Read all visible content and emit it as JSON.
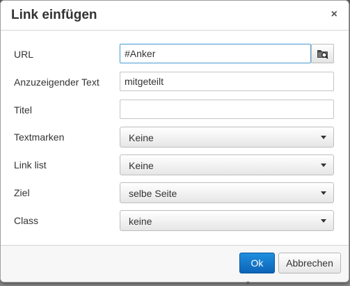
{
  "dialog": {
    "title": "Link einfügen",
    "close_glyph": "×"
  },
  "form": {
    "url": {
      "label": "URL",
      "value": "#Anker",
      "browse_icon": "folder-search-icon"
    },
    "text": {
      "label": "Anzuzeigender Text",
      "value": "mitgeteilt"
    },
    "title": {
      "label": "Titel",
      "value": ""
    },
    "bookmarks": {
      "label": "Textmarken",
      "selected": "Keine"
    },
    "link_list": {
      "label": "Link list",
      "selected": "Keine"
    },
    "target": {
      "label": "Ziel",
      "selected": "selbe Seite"
    },
    "class": {
      "label": "Class",
      "selected": "keine"
    }
  },
  "footer": {
    "ok_label": "Ok",
    "cancel_label": "Abbrechen"
  },
  "colors": {
    "primary_button": "#1779cf",
    "focus_border": "#59a5d8"
  }
}
